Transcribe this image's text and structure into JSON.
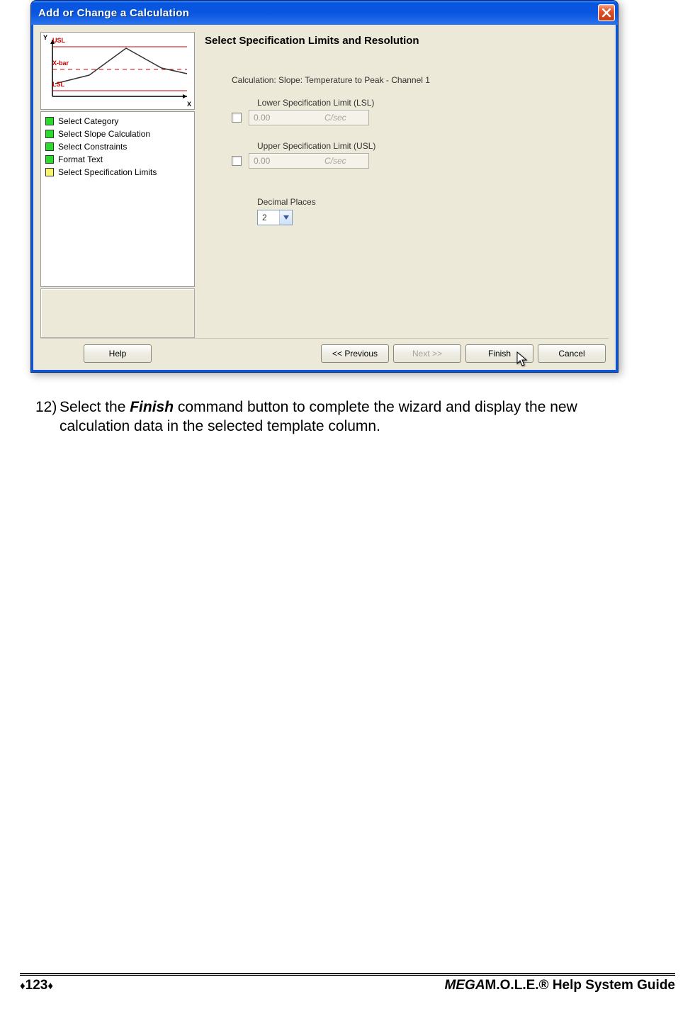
{
  "dialog": {
    "title": "Add or Change a Calculation",
    "panel_title": "Select Specification Limits and Resolution",
    "chart": {
      "y_label": "Y",
      "x_label": "X",
      "usl": "USL",
      "xbar": "X-bar",
      "lsl": "LSL"
    },
    "steps": [
      {
        "label": "Select Category",
        "color": "green"
      },
      {
        "label": "Select Slope Calculation",
        "color": "green"
      },
      {
        "label": "Select Constraints",
        "color": "green"
      },
      {
        "label": "Format Text",
        "color": "green"
      },
      {
        "label": "Select Specification Limits",
        "color": "yellow"
      }
    ],
    "form": {
      "calc_line": "Calculation: Slope: Temperature to Peak - Channel 1",
      "lsl_label": "Lower Specification Limit (LSL)",
      "lsl_value": "0.00",
      "lsl_unit": "C/sec",
      "usl_label": "Upper Specification Limit (USL)",
      "usl_value": "0.00",
      "usl_unit": "C/sec",
      "decimal_label": "Decimal Places",
      "decimal_value": "2"
    },
    "buttons": {
      "help": "Help",
      "previous": "<< Previous",
      "next": "Next >>",
      "finish": "Finish",
      "cancel": "Cancel"
    }
  },
  "instruction": {
    "number": "12)",
    "pre": "Select the ",
    "bold": "Finish",
    "post1": " command button to complete the wizard and display the new",
    "post2": "calculation data in the selected template column."
  },
  "footer": {
    "page_number": "123",
    "title_italic": "MEGA",
    "title_rest": "M.O.L.E.® Help System Guide"
  }
}
